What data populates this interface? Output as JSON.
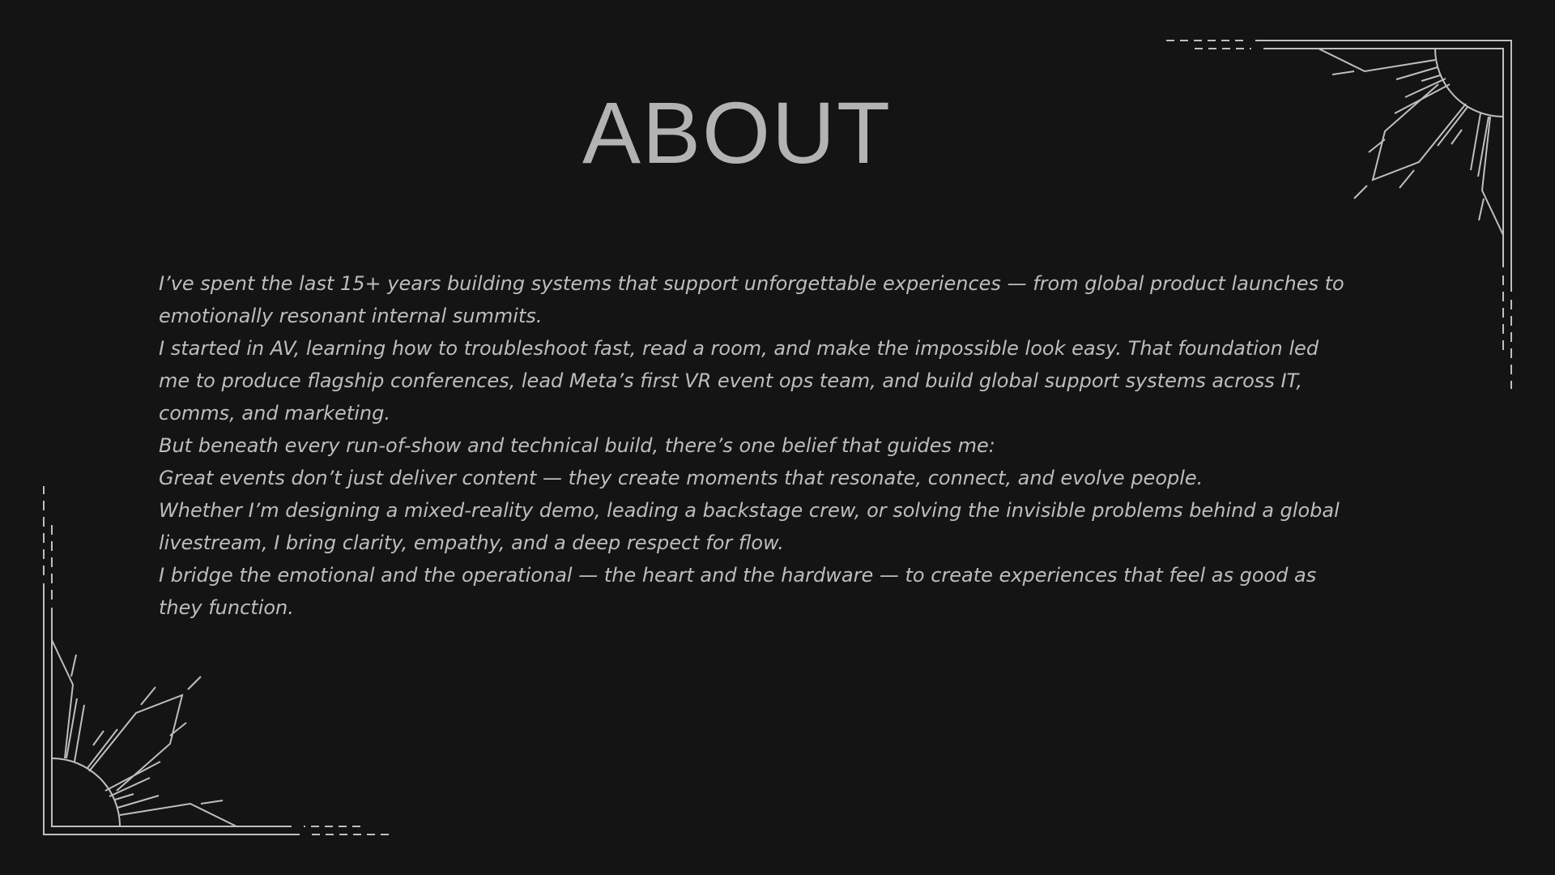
{
  "title": "ABOUT",
  "paragraphs": [
    "I’ve spent the last 15+ years building systems that support unforgettable experiences — from global product launches to emotionally resonant internal summits.",
    "I started in AV, learning how to troubleshoot fast, read a room, and make the impossible look easy. That foundation led me to produce flagship conferences, lead Meta’s first VR event ops team, and build global support systems across IT, comms, and marketing.",
    "But beneath every run-of-show and technical build, there’s one belief that guides me:",
    "Great events don’t just deliver content — they create moments that resonate, connect, and evolve people.",
    "Whether I’m designing a mixed-reality demo, leading a backstage crew, or solving the invisible problems behind a global livestream, I bring clarity, empathy, and a deep respect for flow.",
    "I bridge the emotional and the operational — the heart and the hardware — to create experiences that feel as good as they function."
  ],
  "colors": {
    "background": "#141414",
    "title": "#b3b3b3",
    "text": "#bdbdbd",
    "ornament": "#bfbfbf"
  },
  "ornaments": [
    "sunburst-corner-top-right",
    "sunburst-corner-bottom-left"
  ]
}
